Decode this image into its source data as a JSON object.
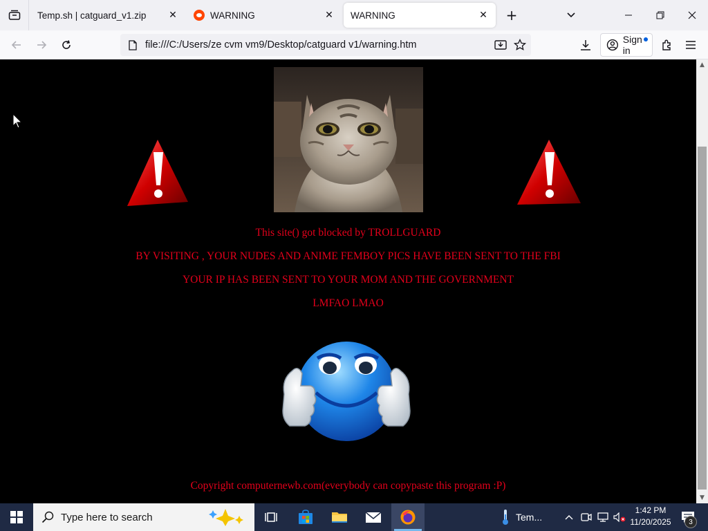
{
  "browser": {
    "tabs": [
      {
        "title": "Temp.sh | catguard_v1.zip",
        "active": false
      },
      {
        "title": "WARNING",
        "active": false,
        "favicon": "reddit-icon"
      },
      {
        "title": "WARNING",
        "active": true
      }
    ],
    "url": "file:///C:/Users/ze cvm vm9/Desktop/catguard v1/warning.htm",
    "signin_label": "Sign in",
    "accent": "#0060df"
  },
  "page": {
    "background": "#000000",
    "text_color": "#e3001b",
    "lines": [
      "This site() got blocked by TROLLGUARD",
      "BY VISITING , YOUR NUDES AND ANIME FEMBOY PICS HAVE BEEN SENT TO THE FBI",
      "YOUR IP HAS BEEN SENT TO YOUR MOM AND THE GOVERNMENT",
      "LMFAO LMAO"
    ],
    "copyright": "Copyright computernewb.com(everybody can copypaste this program :P)"
  },
  "taskbar": {
    "search_placeholder": "Type here to search",
    "weather_label": "Tem...",
    "time": "1:42 PM",
    "date": "11/20/2025",
    "notification_count": "3"
  }
}
